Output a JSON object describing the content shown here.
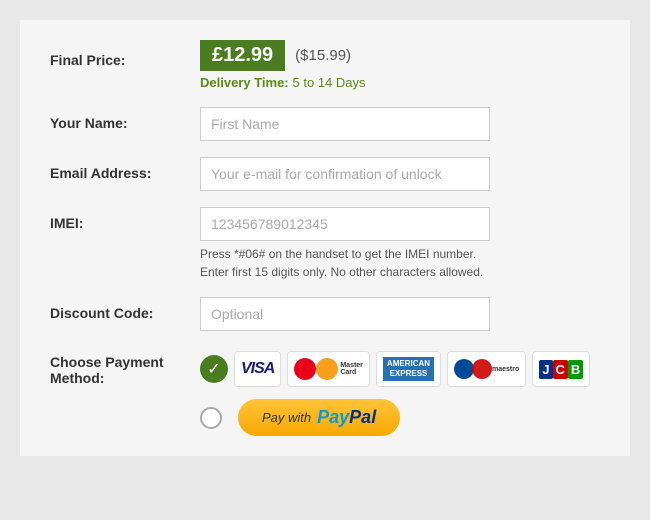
{
  "price": {
    "label": "Final Price:",
    "gbp": "£12.99",
    "usd": "($15.99)"
  },
  "delivery": {
    "label": "Delivery Time:",
    "value": "5 to 14 Days"
  },
  "fields": {
    "name": {
      "label": "Your Name:",
      "placeholder": "First Name"
    },
    "email": {
      "label": "Email Address:",
      "placeholder": "Your e-mail for confirmation of unlock"
    },
    "imei": {
      "label": "IMEI:",
      "placeholder": "123456789012345",
      "hint": "Press *#06# on the handset to get the IMEI number. Enter first 15 digits only. No other characters allowed."
    },
    "discount": {
      "label": "Discount Code:",
      "placeholder": "Optional"
    }
  },
  "payment": {
    "label": "Choose Payment Method:",
    "paypal_btn_text": "Pay with",
    "paypal_brand": "PayPal"
  }
}
